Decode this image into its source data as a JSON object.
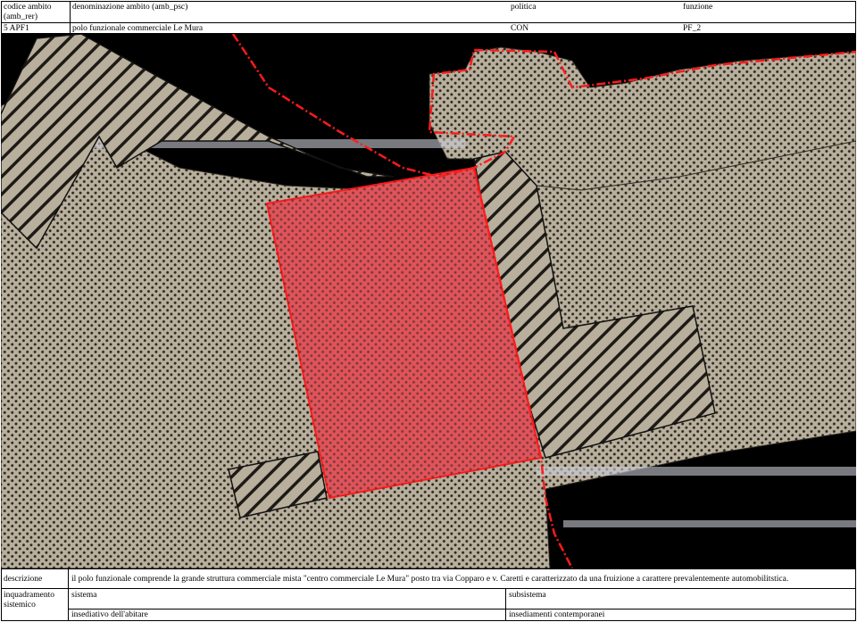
{
  "header": {
    "codice_label": "codice ambito",
    "codice_sub": "(amb_rer)",
    "codice_value": "5 APF1",
    "denominazione_label": "denominazione ambito (amb_psc)",
    "denominazione_value": "polo funzionale commerciale Le Mura",
    "politica_label": "politica",
    "politica_value": "CON",
    "funzione_label": "funzione",
    "funzione_value": "PF_2"
  },
  "map": {
    "colors": {
      "sea_blue": "#9fb2c6",
      "land_tan": "#b8af9c",
      "dot_dark": "#2a2620",
      "hatch_stroke": "#1e1a16",
      "ambit_red": "#e0535a",
      "border_red": "#ff1b1b",
      "road_line": "#c9ccd6"
    }
  },
  "footer": {
    "descrizione_label": "descrizione",
    "descrizione_text": "il polo funzionale comprende la grande struttura commerciale mista \"centro commerciale Le Mura\" posto tra via Copparo e v. Caretti e caratterizzato da una fruizione a carattere prevalentemente automobilitstica.",
    "inquadramento_label_1": "inquadramento",
    "inquadramento_label_2": "sistemico",
    "sistema_label": "sistema",
    "sistema_value": "insediativo dell'abitare",
    "subsistema_label": "subsistema",
    "subsistema_value": "insediamenti contemporanei"
  }
}
